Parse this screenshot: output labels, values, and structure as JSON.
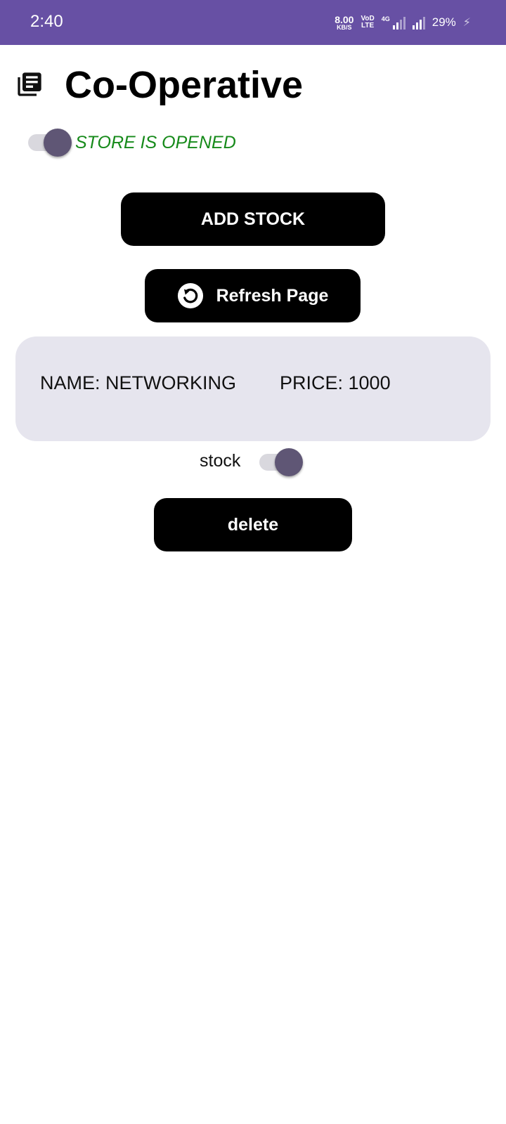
{
  "status_bar": {
    "time": "2:40",
    "net_speed_value": "8.00",
    "net_speed_unit": "KB/S",
    "volte_top": "VoD",
    "volte_bottom": "LTE",
    "network_type": "4G",
    "battery": "29%"
  },
  "header": {
    "title": "Co-Operative",
    "icon": "library-books-icon"
  },
  "store_toggle": {
    "label": "STORE IS OPENED",
    "checked": true,
    "label_color": "#168a1a"
  },
  "actions": {
    "add_stock_label": "ADD STOCK",
    "refresh_label": "Refresh Page"
  },
  "items": [
    {
      "name_label": "NAME: NETWORKING",
      "price_label": "PRICE: 1000",
      "stock_label": "stock",
      "stock_on": true,
      "delete_label": "delete"
    }
  ],
  "colors": {
    "status_bar": "#6750a4",
    "card_background": "#e6e5ee",
    "switch_thumb": "#5f5675",
    "button": "#000000"
  }
}
